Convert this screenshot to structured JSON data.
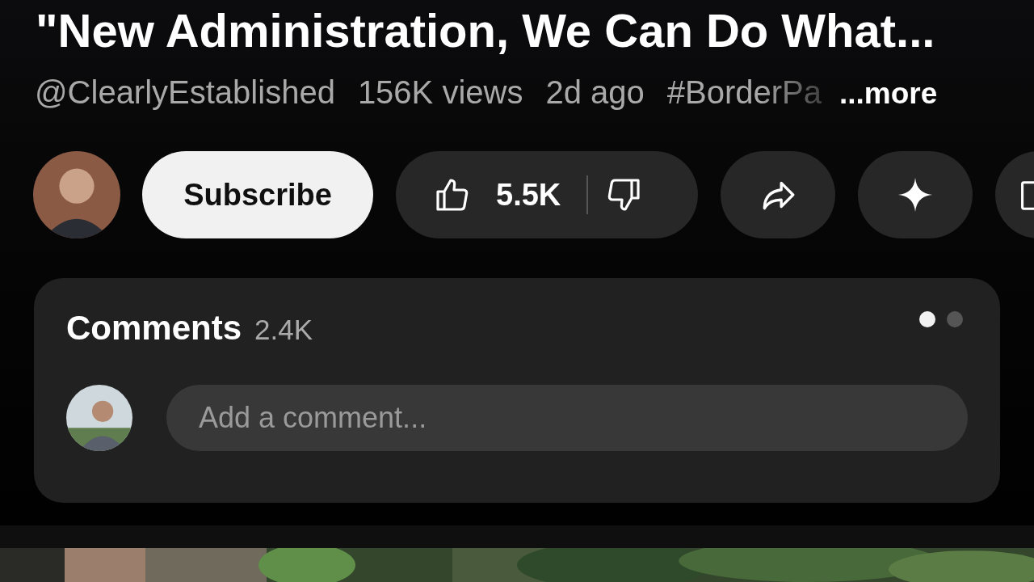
{
  "video": {
    "title": "\"New Administration, We Can Do What...",
    "channel": "@ClearlyEstablished",
    "views": "156K views",
    "age": "2d ago",
    "hashtag": "#BorderPa",
    "more": "...more"
  },
  "actions": {
    "subscribe": "Subscribe",
    "likes": "5.5K"
  },
  "comments": {
    "title": "Comments",
    "count": "2.4K",
    "placeholder": "Add a comment...",
    "pages": [
      {
        "selected": true
      },
      {
        "selected": false
      }
    ]
  }
}
